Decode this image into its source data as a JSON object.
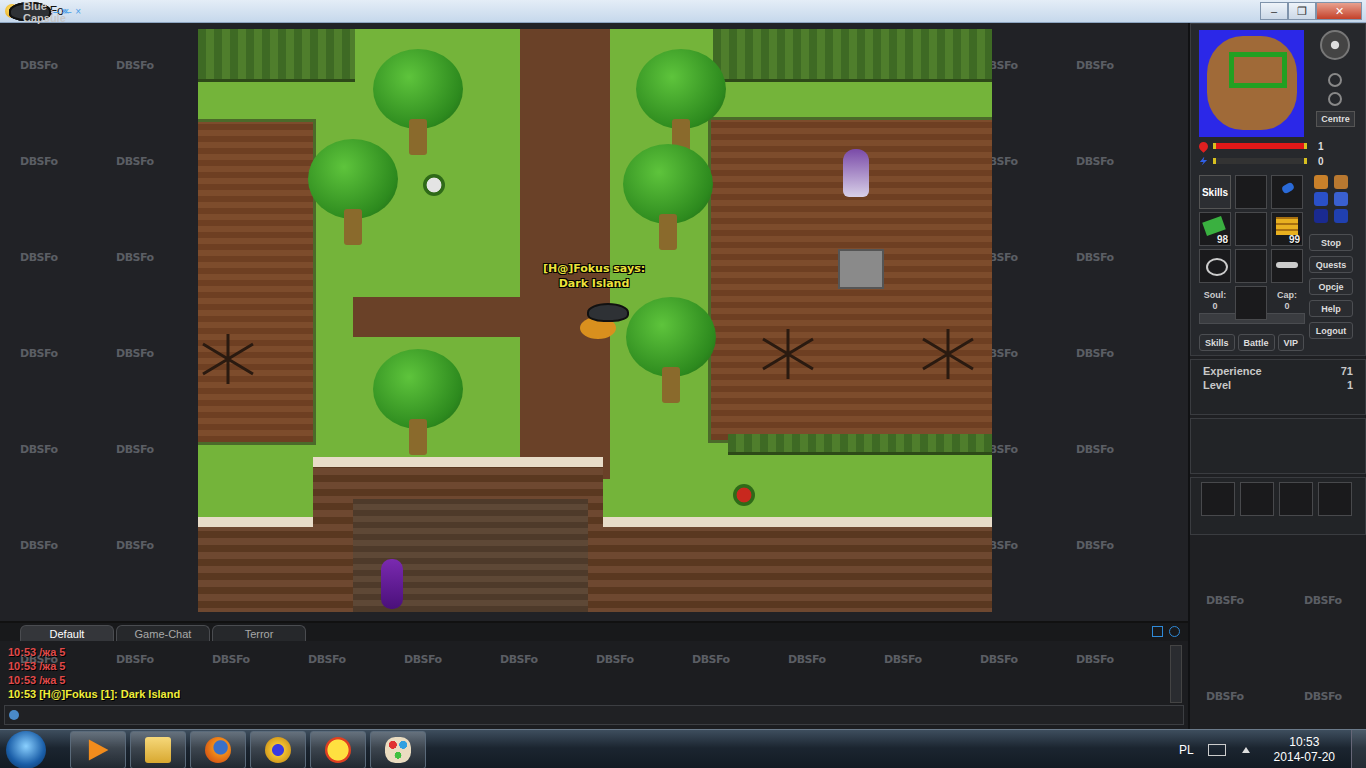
{
  "window": {
    "title": "DBSFo",
    "controls": [
      "–",
      "❐",
      "✕"
    ]
  },
  "watermark": "DBSFo",
  "game": {
    "speaker": "[H@]Fokus says:",
    "speech": "Dark Island"
  },
  "minimap": {
    "centre_button": "Centre"
  },
  "stats": [
    {
      "name": "health",
      "level": 1,
      "value": "1",
      "color": "#e01818"
    },
    {
      "name": "mana",
      "level": 0,
      "value": "0",
      "color": "#2a4fe0"
    }
  ],
  "inventory": {
    "skills_button": "Skills",
    "slots": [
      {
        "count": ""
      },
      {
        "count": ""
      },
      {
        "count": "98"
      },
      {
        "count": ""
      },
      {
        "count": "99"
      },
      {
        "count": ""
      },
      {
        "count": ""
      },
      {
        "count": ""
      },
      {
        "count": ""
      }
    ],
    "soul": {
      "label": "Soul:",
      "value": "0"
    },
    "cap": {
      "label": "Cap:",
      "value": "0"
    }
  },
  "side_buttons": [
    "Stop",
    "Quests",
    "Opcje",
    "Help",
    "Logout"
  ],
  "toggles": [
    "Skills",
    "Battle",
    "VIP"
  ],
  "panels": [
    {
      "title": "Skills",
      "kind": "skills",
      "controls": [
        "–",
        "×"
      ],
      "rows": [
        {
          "label": "Experience",
          "value": "71"
        },
        {
          "label": "Level",
          "value": "1"
        }
      ],
      "slots": []
    },
    {
      "title": "Battle",
      "kind": "list",
      "controls": [
        "–",
        "×"
      ],
      "rows": [],
      "slots": []
    },
    {
      "title": "Blue Capsule",
      "kind": "container",
      "controls": [
        "–",
        "×"
      ],
      "rows": [],
      "slots": [
        {
          "count": ""
        },
        {
          "count": ""
        },
        {
          "count": ""
        },
        {
          "count": ""
        }
      ]
    }
  ],
  "chat": {
    "tabs": [
      {
        "label": "Default",
        "selected": true
      },
      {
        "label": "Game-Chat",
        "selected": false
      },
      {
        "label": "Terror",
        "selected": false
      }
    ],
    "messages": [
      {
        "time": "10:53",
        "text": "/жа 5",
        "color": "#e04a4a"
      },
      {
        "time": "10:53",
        "text": "/жа 5",
        "color": "#e04a4a"
      },
      {
        "time": "10:53",
        "text": "/жа 5",
        "color": "#e04a4a"
      },
      {
        "time": "10:53",
        "text": "[H@]Fokus [1]: Dark Island",
        "color": "#f0ee3a"
      }
    ],
    "input": ""
  },
  "taskbar": {
    "language": "PL",
    "time": "10:53",
    "date": "2014-07-20"
  }
}
